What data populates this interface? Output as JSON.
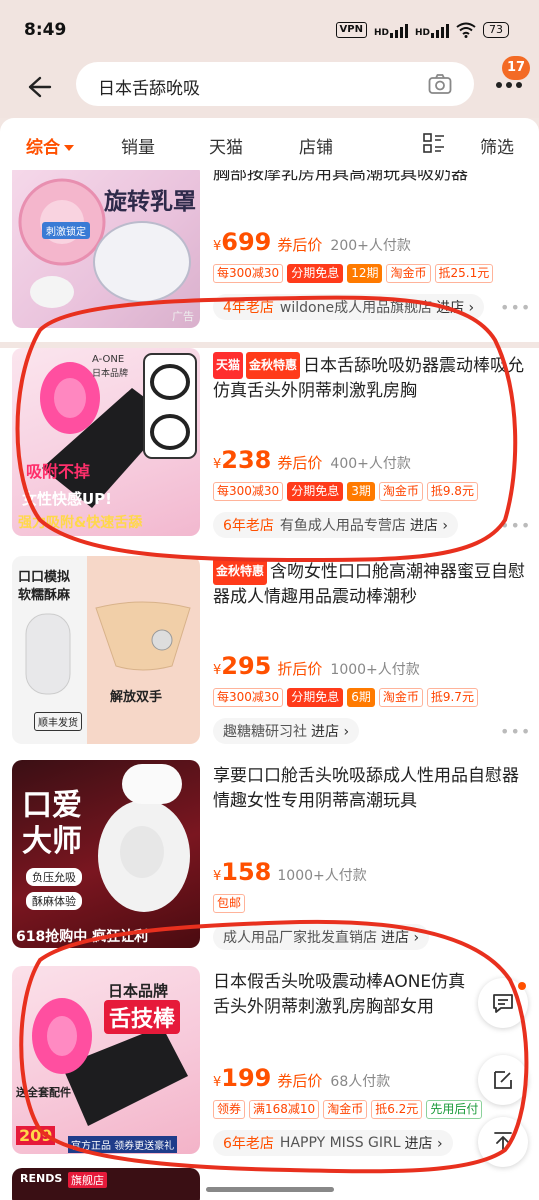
{
  "status_bar": {
    "time": "8:49",
    "vpn": "VPN",
    "hd1": "HD",
    "hd2": "HD",
    "battery": "73"
  },
  "search": {
    "query": "日本舌舔吮吸",
    "badge": "17"
  },
  "filters": {
    "tabs": [
      "综合",
      "销量",
      "天猫",
      "店铺",
      "筛选"
    ]
  },
  "products": [
    {
      "image_text": "旋转乳罩",
      "image_sub": "刺激锁定",
      "ad_label": "广告",
      "tags": [],
      "title": "胸部按摩乳房用具高潮玩具吸奶器",
      "price": "699",
      "price_label": "券后价",
      "sold": "200+人付款",
      "promos": [
        "每300减30",
        "分期免息",
        "12期",
        "淘金币",
        "抵25.1元"
      ],
      "shop_years": "4年老店",
      "shop_name": "wildone成人用品旗舰店",
      "shop_go": "进店 ›"
    },
    {
      "image_brand": "A-ONE",
      "image_brand_sub": "日本品牌",
      "image_text1": "吸附不掉",
      "image_text2": "女性快感UP!",
      "image_text3": "强力吸附&快速舌舔",
      "tags": [
        "天猫",
        "金秋特惠"
      ],
      "title": "日本舌舔吮吸奶器震动棒吸允仿真舌头外阴蒂刺激乳房胸",
      "price": "238",
      "price_label": "券后价",
      "sold": "400+人付款",
      "promos": [
        "每300减30",
        "分期免息",
        "3期",
        "淘金币",
        "抵9.8元"
      ],
      "shop_years": "6年老店",
      "shop_name": "有鱼成人用品专营店",
      "shop_go": "进店 ›"
    },
    {
      "image_text1": "口口模拟",
      "image_text2": "软糯酥麻",
      "image_text3": "解放双手",
      "image_text4": "顺丰发货",
      "tags": [
        "金秋特惠"
      ],
      "title": "含吻女性口口舱高潮神器蜜豆自慰器成人情趣用品震动棒潮秒",
      "price": "295",
      "price_label": "折后价",
      "sold": "1000+人付款",
      "promos": [
        "每300减30",
        "分期免息",
        "6期",
        "淘金币",
        "抵9.7元"
      ],
      "shop_years": "",
      "shop_name": "趣糖糖研习社",
      "shop_go": "进店 ›"
    },
    {
      "image_text1": "口爱",
      "image_text2": "大师",
      "image_text3": "负压允吸",
      "image_text4": "酥麻体验",
      "image_text5": "618抢购中 疯狂让利",
      "tags": [],
      "title": "享要口口舱舌头吮吸舔成人性用品自慰器情趣女性专用阴蒂高潮玩具",
      "price": "158",
      "price_label": "",
      "sold": "1000+人付款",
      "promos": [
        "包邮"
      ],
      "shop_years": "",
      "shop_name": "成人用品厂家批发直销店",
      "shop_go": "进店 ›"
    },
    {
      "image_text1": "日本品牌",
      "image_text2": "舌技棒",
      "image_text3": "送全套配件",
      "image_text4": "209",
      "image_text5": "官方正品 领券更送豪礼",
      "tags": [],
      "title": "日本假舌头吮吸震动棒AONE仿真舌头外阴蒂刺激乳房胸部女用",
      "price": "199",
      "price_label": "券后价",
      "sold": "68人付款",
      "promos": [
        "领券",
        "满168减10",
        "淘金币",
        "抵6.2元",
        "先用后付"
      ],
      "shop_years": "6年老店",
      "shop_name": "HAPPY MISS GIRL",
      "shop_go": "进店 ›"
    }
  ],
  "bottom_peek": {
    "brand": "RENDS",
    "tag": "旗舰店"
  },
  "colors": {
    "accent": "#ff5000",
    "annotation": "#e8301e",
    "background": "#f2e6e2"
  },
  "icons": [
    "back-arrow-icon",
    "camera-icon",
    "more-icon",
    "layout-toggle-icon",
    "chat-icon",
    "edit-icon",
    "scroll-top-icon"
  ]
}
